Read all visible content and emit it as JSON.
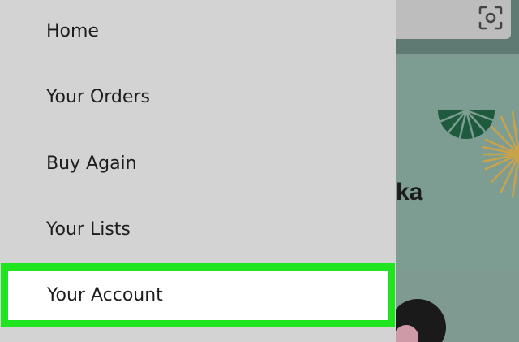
{
  "menu": {
    "items": [
      {
        "label": "Home"
      },
      {
        "label": "Your Orders"
      },
      {
        "label": "Buy Again"
      },
      {
        "label": "Your Lists"
      },
      {
        "label": "Your Account",
        "highlighted": true
      }
    ]
  },
  "background": {
    "partial_text": "ka"
  },
  "icons": {
    "search_bar": "camera-scan-icon"
  },
  "colors": {
    "drawer": "#d3d3d3",
    "highlight_border": "#1fe41f",
    "highlight_fill": "#ffffff",
    "text": "#1d1d1d"
  }
}
